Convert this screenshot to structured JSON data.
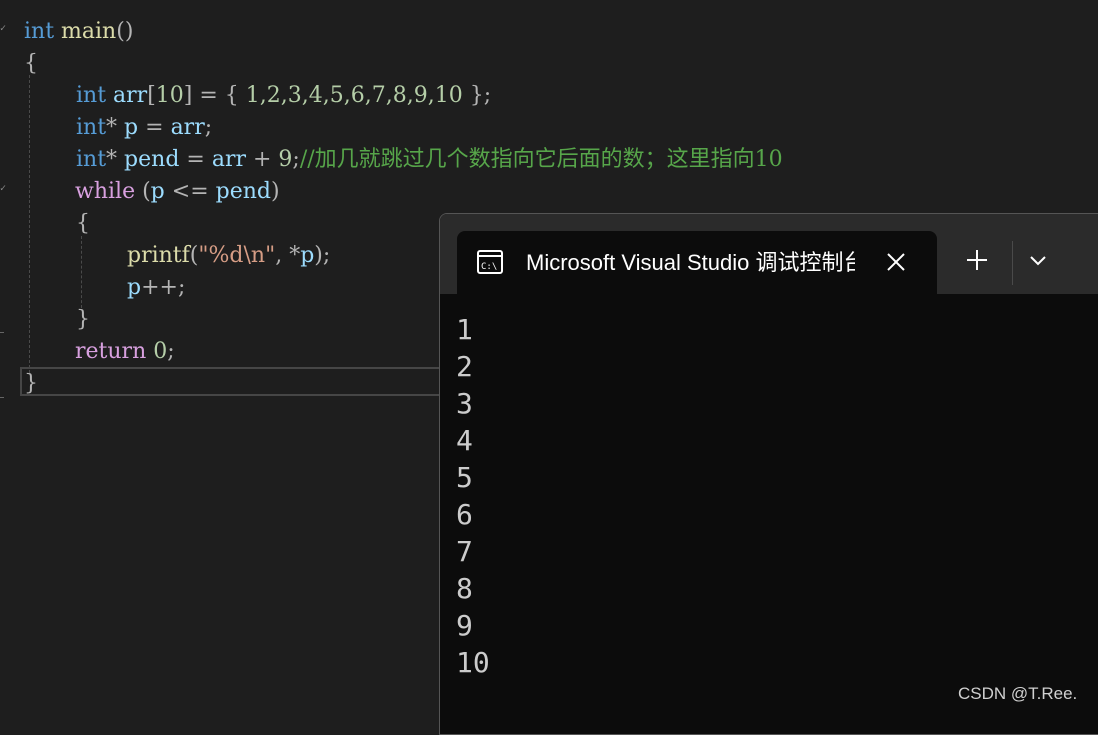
{
  "editor": {
    "lines": [
      {
        "tokens": [
          {
            "t": "int",
            "c": "kw"
          },
          {
            "t": " ",
            "c": ""
          },
          {
            "t": "main",
            "c": "fn"
          },
          {
            "t": "()",
            "c": "punc"
          }
        ]
      },
      {
        "tokens": [
          {
            "t": "{",
            "c": "punc"
          }
        ]
      },
      {
        "tokens": [
          {
            "t": "int",
            "c": "kw"
          },
          {
            "t": " ",
            "c": ""
          },
          {
            "t": "arr",
            "c": "var"
          },
          {
            "t": "[",
            "c": "punc"
          },
          {
            "t": "10",
            "c": "num"
          },
          {
            "t": "] = { ",
            "c": "punc"
          },
          {
            "t": "1,2,3,4,5,6,7,8,9,10",
            "c": "num"
          },
          {
            "t": " };",
            "c": "punc"
          }
        ]
      },
      {
        "tokens": [
          {
            "t": "int",
            "c": "kw"
          },
          {
            "t": "* ",
            "c": "punc"
          },
          {
            "t": "p",
            "c": "var"
          },
          {
            "t": " = ",
            "c": "punc"
          },
          {
            "t": "arr",
            "c": "var"
          },
          {
            "t": ";",
            "c": "punc"
          }
        ]
      },
      {
        "tokens": [
          {
            "t": "int",
            "c": "kw"
          },
          {
            "t": "* ",
            "c": "punc"
          },
          {
            "t": "pend",
            "c": "var"
          },
          {
            "t": " = ",
            "c": "punc"
          },
          {
            "t": "arr",
            "c": "var"
          },
          {
            "t": " + ",
            "c": "punc"
          },
          {
            "t": "9",
            "c": "num"
          },
          {
            "t": ";",
            "c": "punc"
          },
          {
            "t": "//加几就跳过几个数指向它后面的数；这里指向10",
            "c": "cmt"
          }
        ]
      },
      {
        "tokens": [
          {
            "t": "while",
            "c": "ctl"
          },
          {
            "t": " (",
            "c": "punc"
          },
          {
            "t": "p",
            "c": "var"
          },
          {
            "t": " <= ",
            "c": "punc"
          },
          {
            "t": "pend",
            "c": "var"
          },
          {
            "t": ")",
            "c": "punc"
          }
        ]
      },
      {
        "tokens": [
          {
            "t": "{",
            "c": "punc"
          }
        ]
      },
      {
        "tokens": [
          {
            "t": "printf",
            "c": "fn"
          },
          {
            "t": "(",
            "c": "punc"
          },
          {
            "t": "\"%d\\n\"",
            "c": "str"
          },
          {
            "t": ", *",
            "c": "punc"
          },
          {
            "t": "p",
            "c": "var"
          },
          {
            "t": ");",
            "c": "punc"
          }
        ]
      },
      {
        "tokens": [
          {
            "t": "p",
            "c": "var"
          },
          {
            "t": "++;",
            "c": "punc"
          }
        ]
      },
      {
        "tokens": [
          {
            "t": "}",
            "c": "punc"
          }
        ]
      },
      {
        "tokens": [
          {
            "t": "return",
            "c": "ctl"
          },
          {
            "t": " ",
            "c": ""
          },
          {
            "t": "0",
            "c": "num"
          },
          {
            "t": ";",
            "c": "punc"
          }
        ]
      },
      {
        "tokens": [
          {
            "t": "}",
            "c": "punc"
          }
        ]
      }
    ]
  },
  "terminal": {
    "tab_title": "Microsoft Visual Studio 调试控制台",
    "icon": "console-icon",
    "output": [
      "1",
      "2",
      "3",
      "4",
      "5",
      "6",
      "7",
      "8",
      "9",
      "10"
    ]
  },
  "watermark": "CSDN @T.Ree."
}
